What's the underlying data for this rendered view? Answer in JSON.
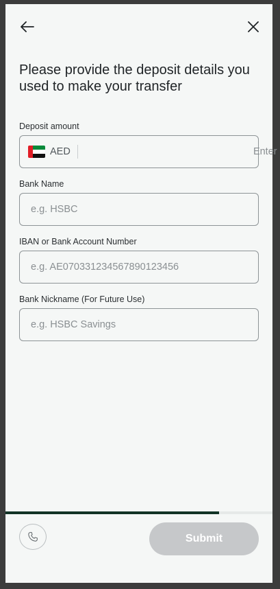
{
  "header": {
    "back_icon": "arrow-left-icon",
    "close_icon": "close-icon",
    "title": "Please provide the deposit details you used to make your transfer"
  },
  "form": {
    "deposit_amount": {
      "label": "Deposit amount",
      "currency": "AED",
      "flag_icon": "uae-flag-icon",
      "placeholder": "Enter amount",
      "value": ""
    },
    "bank_name": {
      "label": "Bank Name",
      "placeholder": "e.g. HSBC",
      "value": ""
    },
    "iban": {
      "label": "IBAN or Bank Account Number",
      "placeholder": "e.g. AE070331234567890123456",
      "value": ""
    },
    "bank_nickname": {
      "label": "Bank Nickname (For Future Use)",
      "placeholder": "e.g. HSBC Savings",
      "value": ""
    }
  },
  "progress": {
    "fraction": 0.8
  },
  "footer": {
    "phone_icon": "phone-icon",
    "submit_label": "Submit"
  },
  "colors": {
    "primary_dark": "#123326",
    "submit_disabled": "#c6c8ca",
    "background": "#f5f7f6"
  }
}
